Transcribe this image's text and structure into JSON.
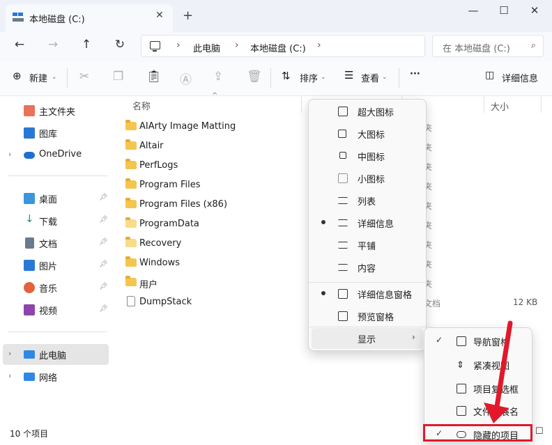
{
  "titlebar": {
    "tab_title": "本地磁盘 (C:)",
    "close_tab": "✕",
    "new_tab": "+",
    "minimize": "—",
    "maximize": "☐",
    "close": "✕"
  },
  "navigation": {
    "back": "←",
    "forward": "→",
    "up": "↑",
    "refresh": "↻",
    "breadcrumbs": [
      "此电脑",
      "本地磁盘 (C:)"
    ],
    "search_placeholder": "在 本地磁盘 (C:)"
  },
  "commandbar": {
    "new_label": "新建",
    "sort_label": "排序",
    "view_label": "查看",
    "more_label": "···",
    "details_label": "详细信息"
  },
  "sidebar": {
    "items": [
      {
        "label": "主文件夹",
        "icon": "home-icon",
        "color": "#e8735a"
      },
      {
        "label": "图库",
        "icon": "gallery-icon",
        "color": "#2a78d6"
      },
      {
        "label": "OneDrive",
        "icon": "cloud-icon",
        "color": "#1f6fd1"
      },
      {
        "label": "桌面",
        "icon": "desktop-icon",
        "color": "#3a96dd"
      },
      {
        "label": "下载",
        "icon": "download-icon",
        "color": "#1a9c5a"
      },
      {
        "label": "文档",
        "icon": "document-icon",
        "color": "#6a7b8c"
      },
      {
        "label": "图片",
        "icon": "picture-icon",
        "color": "#2a78d6"
      },
      {
        "label": "音乐",
        "icon": "music-icon",
        "color": "#e3623c"
      },
      {
        "label": "视频",
        "icon": "video-icon",
        "color": "#8e44ad"
      },
      {
        "label": "此电脑",
        "icon": "computer-icon",
        "color": "#2d89e5"
      },
      {
        "label": "网络",
        "icon": "network-icon",
        "color": "#2d89e5"
      }
    ]
  },
  "filelist": {
    "col_name": "名称",
    "col_size": "大小",
    "files": [
      {
        "name": "AIArty Image Matting",
        "type_frag": "夹"
      },
      {
        "name": "Altair",
        "type_frag": "夹"
      },
      {
        "name": "PerfLogs",
        "type_frag": "夹"
      },
      {
        "name": "Program Files",
        "type_frag": "夹"
      },
      {
        "name": "Program Files (x86)",
        "type_frag": "夹"
      },
      {
        "name": "ProgramData",
        "type_frag": "夹"
      },
      {
        "name": "Recovery",
        "type_frag": "夹"
      },
      {
        "name": "Windows",
        "type_frag": "夹"
      },
      {
        "name": "用户",
        "type_frag": "夹"
      },
      {
        "name": "DumpStack",
        "type_frag": "文档",
        "size": "12 KB"
      }
    ]
  },
  "statusbar": {
    "count": "10 个项目"
  },
  "view_menu": {
    "items": [
      {
        "label": "超大图标"
      },
      {
        "label": "大图标"
      },
      {
        "label": "中图标"
      },
      {
        "label": "小图标"
      },
      {
        "label": "列表"
      },
      {
        "label": "详细信息"
      },
      {
        "label": "平铺"
      },
      {
        "label": "内容"
      },
      {
        "label": "详细信息窗格"
      },
      {
        "label": "预览窗格"
      },
      {
        "label": "显示"
      }
    ]
  },
  "show_menu": {
    "items": [
      {
        "label": "导航窗格",
        "checked": "✓"
      },
      {
        "label": "紧凑视图",
        "checked": ""
      },
      {
        "label": "项目复选框",
        "checked": ""
      },
      {
        "label": "文件扩展名",
        "checked": ""
      },
      {
        "label": "隐藏的项目",
        "checked": "✓"
      }
    ]
  },
  "colors": {
    "highlight": "#e2182b",
    "folder": "#f4c64f"
  }
}
